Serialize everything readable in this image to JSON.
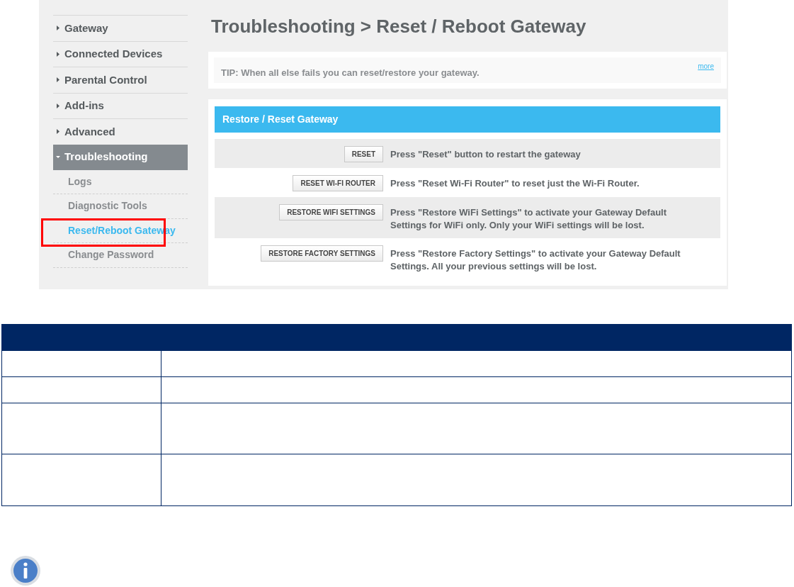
{
  "sidebar": {
    "items": [
      {
        "label": "Gateway",
        "expanded": false
      },
      {
        "label": "Connected Devices",
        "expanded": false
      },
      {
        "label": "Parental Control",
        "expanded": false
      },
      {
        "label": "Add-ins",
        "expanded": false
      },
      {
        "label": "Advanced",
        "expanded": false
      },
      {
        "label": "Troubleshooting",
        "expanded": true,
        "children": [
          {
            "label": "Logs",
            "selected": false,
            "highlighted": false
          },
          {
            "label": "Diagnostic Tools",
            "selected": false,
            "highlighted": false
          },
          {
            "label": "Reset/Reboot Gateway",
            "selected": true,
            "highlighted": true
          },
          {
            "label": "Change Password",
            "selected": false,
            "highlighted": false
          }
        ]
      }
    ]
  },
  "page_title": "Troubleshooting > Reset / Reboot Gateway",
  "tip": {
    "text": "TIP: When all else fails you can reset/restore your gateway.",
    "link": "more"
  },
  "section": {
    "title": "Restore / Reset Gateway",
    "rows": [
      {
        "button": "RESET",
        "description": "Press \"Reset\" button to restart the gateway"
      },
      {
        "button": "RESET WI-FI ROUTER",
        "description": "Press \"Reset Wi-Fi Router\" to reset just the Wi-Fi Router."
      },
      {
        "button": "RESTORE WIFI SETTINGS",
        "description": "Press \"Restore WiFi Settings\" to activate your Gateway Default Settings for WiFi only. Only your WiFi settings will be lost."
      },
      {
        "button": "RESTORE FACTORY SETTINGS",
        "description": "Press \"Restore Factory Settings\" to activate your Gateway Default Settings. All your previous settings will be lost."
      }
    ]
  }
}
